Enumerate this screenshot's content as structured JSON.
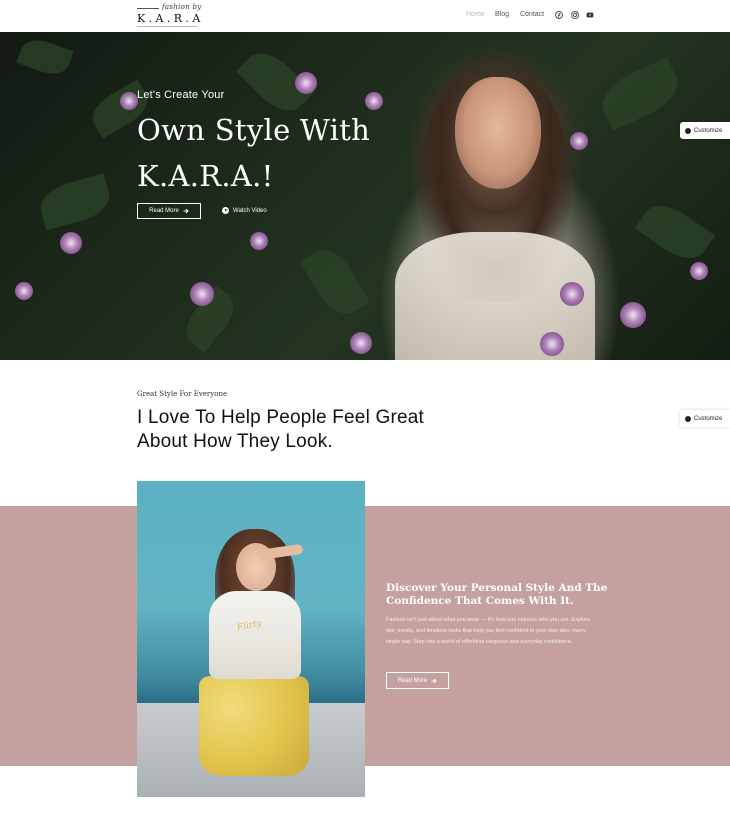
{
  "header": {
    "logo_script": "fashion by",
    "logo_mark": "K.A.R.A",
    "nav": [
      {
        "label": "Home",
        "active": true
      },
      {
        "label": "Blog",
        "active": false
      },
      {
        "label": "Contact",
        "active": false
      }
    ],
    "social_icons": [
      "pinterest-icon",
      "instagram-icon",
      "youtube-icon"
    ]
  },
  "hero": {
    "subtitle": "Let's Create Your",
    "title_line1": "Own Style With",
    "title_line2": "K.A.R.A.!",
    "button_label": "Read More",
    "watch_label": "Watch Video"
  },
  "customize_label": "Customize",
  "intro": {
    "kicker": "Great Style For Everyone",
    "title_line1": "I Love To Help People Feel Great",
    "title_line2": "About How They Look."
  },
  "feature": {
    "photo_text": "Flirty",
    "title_line1": "Discover Your Personal Style And The",
    "title_line2": "Confidence That Comes With It.",
    "body": "Fashion isn't just about what you wear — it's how you express who you are. Explore tips, trends, and timeless looks that help you feel confident in your own skin, every single day. Step into a world of effortless elegance and everyday confidence.",
    "button_label": "Read More"
  },
  "colors": {
    "pink_section": "#c4a19e",
    "text_dark": "#111111",
    "white": "#ffffff"
  }
}
